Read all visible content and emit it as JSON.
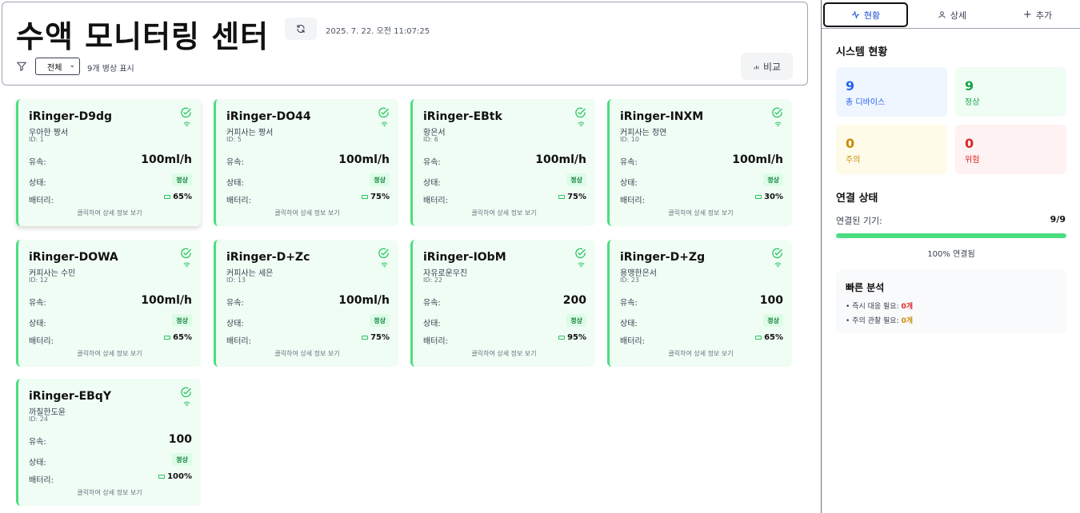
{
  "header": {
    "title": "수액 모니터링 센터",
    "timestamp": "2025. 7. 22. 오전 11:07:25",
    "filter_value": "전체",
    "count_text": "9개 병상 표시",
    "compare_label": "비교"
  },
  "common": {
    "flow_label": "유속:",
    "state_label": "상태:",
    "battery_label": "배터리:",
    "hint": "클릭하여 상세 정보 보기"
  },
  "cards": [
    {
      "name": "iRinger-D9dg",
      "patient": "우아한 짱서",
      "id": "ID: 1",
      "flow": "100ml/h",
      "status": "정상",
      "battery": "65%"
    },
    {
      "name": "iRinger-DO44",
      "patient": "커피사는 짱서",
      "id": "ID: 5",
      "flow": "100ml/h",
      "status": "정상",
      "battery": "75%"
    },
    {
      "name": "iRinger-EBtk",
      "patient": "황은서",
      "id": "ID: 6",
      "flow": "100ml/h",
      "status": "정상",
      "battery": "75%"
    },
    {
      "name": "iRinger-INXM",
      "patient": "커피사는 정연",
      "id": "ID: 10",
      "flow": "100ml/h",
      "status": "정상",
      "battery": "30%"
    },
    {
      "name": "iRinger-DOWA",
      "patient": "커피사는 수민",
      "id": "ID: 12",
      "flow": "100ml/h",
      "status": "정상",
      "battery": "65%"
    },
    {
      "name": "iRinger-D+Zc",
      "patient": "커피사는 세은",
      "id": "ID: 13",
      "flow": "100ml/h",
      "status": "정상",
      "battery": "75%"
    },
    {
      "name": "iRinger-IObM",
      "patient": "자유로운우진",
      "id": "ID: 22",
      "flow": "200",
      "status": "정상",
      "battery": "95%"
    },
    {
      "name": "iRinger-D+Zg",
      "patient": "용맹한은서",
      "id": "ID: 23",
      "flow": "100",
      "status": "정상",
      "battery": "65%"
    },
    {
      "name": "iRinger-EBqY",
      "patient": "까칠한도윤",
      "id": "ID: 24",
      "flow": "100",
      "status": "정상",
      "battery": "100%"
    }
  ],
  "sidebar": {
    "tabs": [
      {
        "label": "현황",
        "icon": "activity-icon"
      },
      {
        "label": "상세",
        "icon": "user-icon"
      },
      {
        "label": "추가",
        "icon": "plus-icon"
      }
    ],
    "system_title": "시스템 현황",
    "stats": [
      {
        "value": "9",
        "label": "총 디바이스",
        "color": "#2563eb",
        "bg": "#eff6ff"
      },
      {
        "value": "9",
        "label": "정상",
        "color": "#16a34a",
        "bg": "#f0fdf4"
      },
      {
        "value": "0",
        "label": "주의",
        "color": "#ca8a04",
        "bg": "#fefce8"
      },
      {
        "value": "0",
        "label": "위험",
        "color": "#dc2626",
        "bg": "#fef2f2"
      }
    ],
    "connection_title": "연결 상태",
    "connected_label": "연결된 기기:",
    "connected_value": "9/9",
    "connected_fraction": 1.0,
    "connected_pct_text": "100% 연결됨",
    "quick_title": "빠른 분석",
    "quick_items": [
      {
        "label": "• 즉시 대응 필요: ",
        "value": "0개",
        "color": "#dc2626"
      },
      {
        "label": "• 주의 관찰 필요: ",
        "value": "0개",
        "color": "#ca8a04"
      }
    ]
  }
}
